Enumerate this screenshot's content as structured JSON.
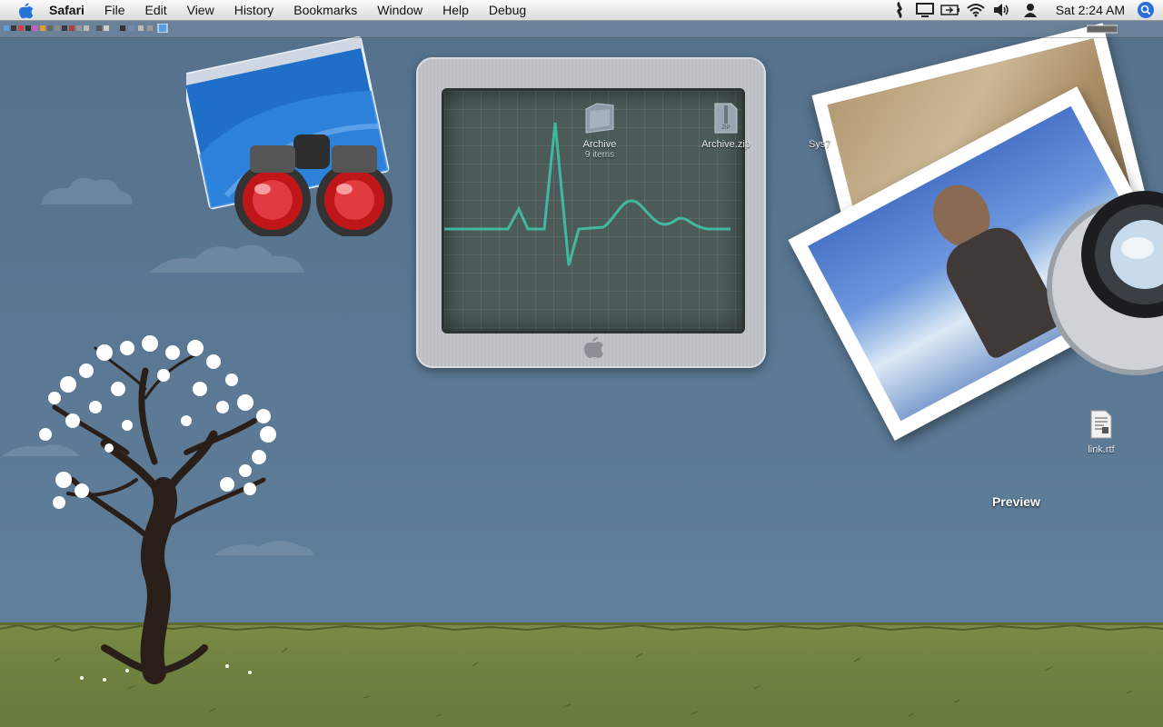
{
  "menubar": {
    "app_name": "Safari",
    "menus": [
      "File",
      "Edit",
      "View",
      "History",
      "Bookmarks",
      "Window",
      "Help",
      "Debug"
    ],
    "clock": "Sat 2:24 AM",
    "status_icons": [
      "script-menu-icon",
      "display-mirror-icon",
      "battery-icon",
      "wifi-icon",
      "volume-icon",
      "user-icon"
    ],
    "spotlight_icon": "spotlight-icon"
  },
  "desktop": {
    "icons": [
      {
        "label": "Archive",
        "sub": "9 items",
        "icon": "folder-icon"
      },
      {
        "label": "Archive.zip",
        "icon": "zip-file-icon"
      },
      {
        "label": "Sys7",
        "icon": "document-icon"
      },
      {
        "label": "link.rtf",
        "icon": "rtf-file-icon"
      }
    ],
    "dock_label": "Preview"
  },
  "apps": {
    "automator": "automator-icon",
    "activity_monitor": "activity-monitor-icon",
    "preview": "preview-icon"
  },
  "colors": {
    "sky": "#5b7791",
    "grass": "#6f8240",
    "heartbeat": "#3fc2a9"
  }
}
